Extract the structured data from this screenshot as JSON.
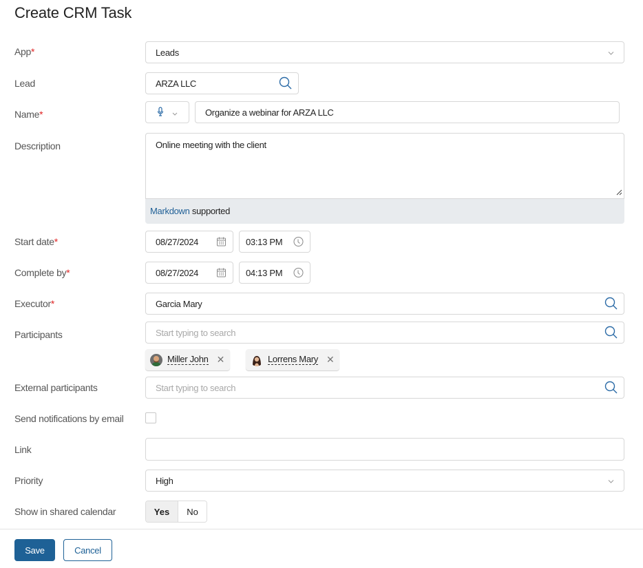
{
  "page": {
    "title": "Create CRM Task"
  },
  "fields": {
    "app": {
      "label": "App",
      "required": "*",
      "value": "Leads"
    },
    "lead": {
      "label": "Lead",
      "value": "ARZA LLC"
    },
    "name": {
      "label": "Name",
      "required": "*",
      "value": "Organize a webinar for ARZA LLC"
    },
    "description": {
      "label": "Description",
      "value": "Online meeting with the client",
      "note_link": "Markdown",
      "note_text": " supported"
    },
    "start_date": {
      "label": "Start date",
      "required": "*",
      "date": "08/27/2024",
      "time": "03:13 PM"
    },
    "complete_by": {
      "label": "Complete by",
      "required": "*",
      "date": "08/27/2024",
      "time": "04:13 PM"
    },
    "executor": {
      "label": "Executor",
      "required": "*",
      "value": "Garcia Mary"
    },
    "participants": {
      "label": "Participants",
      "placeholder": "Start typing to search",
      "chips": [
        {
          "name": "Miller John"
        },
        {
          "name": "Lorrens Mary"
        }
      ]
    },
    "external_participants": {
      "label": "External participants",
      "placeholder": "Start typing to search"
    },
    "send_notifications": {
      "label": "Send notifications by email",
      "checked": false
    },
    "link": {
      "label": "Link",
      "value": ""
    },
    "priority": {
      "label": "Priority",
      "value": "High"
    },
    "shared_calendar": {
      "label": "Show in shared calendar",
      "options": [
        "Yes",
        "No"
      ],
      "selected": "Yes"
    }
  },
  "actions": {
    "save": "Save",
    "cancel": "Cancel"
  },
  "colors": {
    "accent": "#1e6196",
    "required": "#e02424",
    "icon": "#2a6aa6"
  }
}
